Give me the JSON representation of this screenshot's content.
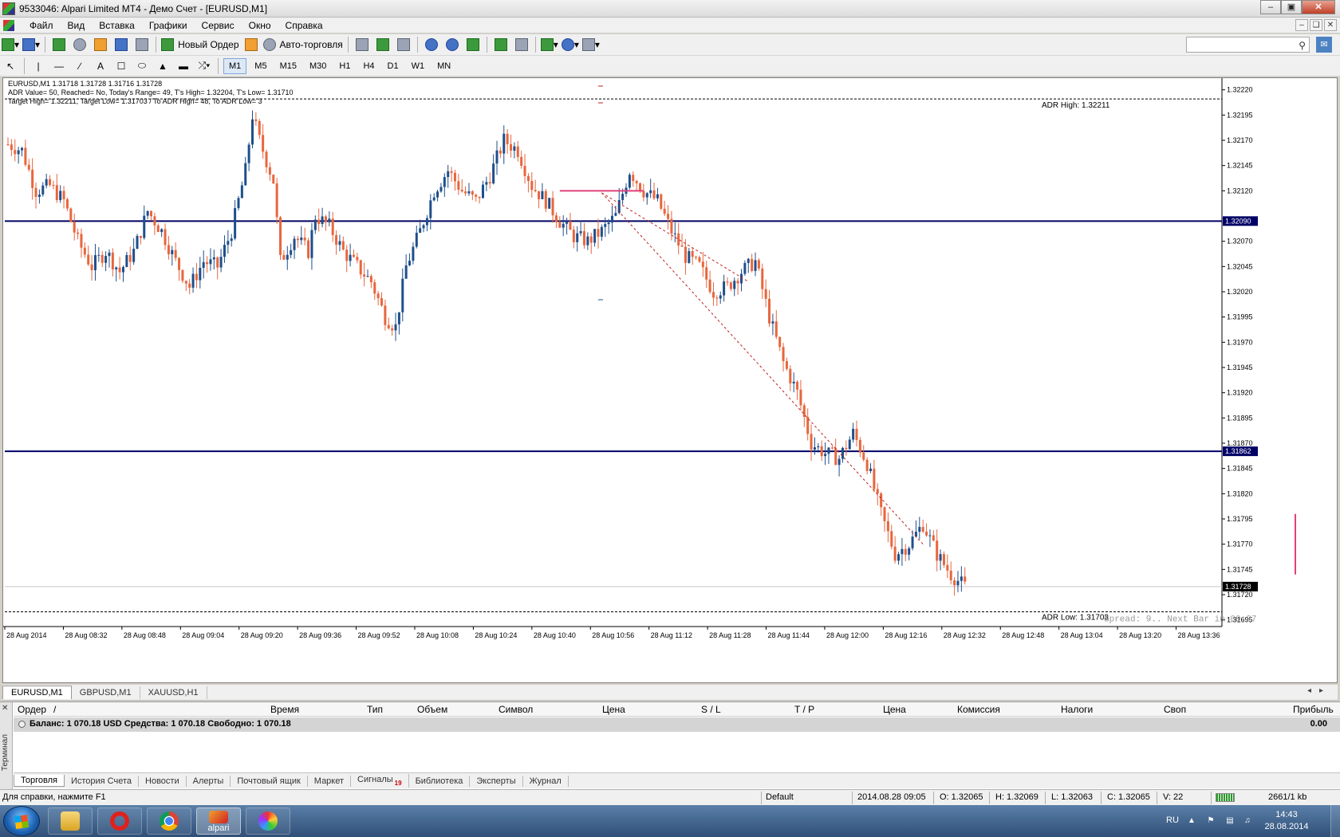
{
  "window": {
    "title": "9533046: Alpari Limited MT4 - Демо Счет - [EURUSD,M1]"
  },
  "menu": [
    "Файл",
    "Вид",
    "Вставка",
    "Графики",
    "Сервис",
    "Окно",
    "Справка"
  ],
  "toolbar": {
    "new_order_label": "Новый Ордер",
    "auto_trading_label": "Авто-торговля"
  },
  "timeframes": [
    "M1",
    "M5",
    "M15",
    "M30",
    "H1",
    "H4",
    "D1",
    "W1",
    "MN"
  ],
  "active_timeframe": "M1",
  "chart": {
    "info_line1": "EURUSD,M1  1.31718 1.31728 1.31716 1.31728",
    "info_line2": "ADR Value= 50, Reached= No, Today's Range= 49, T's High= 1.32204, T's Low= 1.31710",
    "info_line3": "Target High= 1.32211, Target Low= 1.31703 / To ADR High= 48, To ADR Low= 3",
    "adr_high_label": "ADR High: 1.32211",
    "adr_low_label": "ADR Low: 1.31703",
    "spread_label": "Spread: 9.. Next Bar in 00:27",
    "colors": {
      "bull": "#1e4f8c",
      "bear": "#e8663d",
      "hline": "#000066",
      "trend": "#c02020",
      "marker": "#e0407a"
    }
  },
  "chart_data": {
    "type": "candlestick",
    "symbol": "EURUSD",
    "timeframe": "M1",
    "ylim": [
      1.3169,
      1.3223
    ],
    "y_ticks": [
      1.3222,
      1.32195,
      1.3217,
      1.32145,
      1.3212,
      1.3207,
      1.32045,
      1.3202,
      1.31995,
      1.3197,
      1.31945,
      1.3192,
      1.31895,
      1.3187,
      1.31845,
      1.3182,
      1.31795,
      1.3177,
      1.31745,
      1.3172,
      1.31695
    ],
    "y_tick_labels": [
      "1.32220",
      "1.32195",
      "1.32170",
      "1.32145",
      "1.32120",
      "1.32070",
      "1.32045",
      "1.32020",
      "1.31995",
      "1.31970",
      "1.31945",
      "1.31920",
      "1.31895",
      "1.31870",
      "1.31845",
      "1.31820",
      "1.31795",
      "1.31770",
      "1.31745",
      "1.31720",
      "1.31695"
    ],
    "x_labels": [
      "28 Aug 2014",
      "28 Aug 08:32",
      "28 Aug 08:48",
      "28 Aug 09:04",
      "28 Aug 09:20",
      "28 Aug 09:36",
      "28 Aug 09:52",
      "28 Aug 10:08",
      "28 Aug 10:24",
      "28 Aug 10:40",
      "28 Aug 10:56",
      "28 Aug 11:12",
      "28 Aug 11:28",
      "28 Aug 11:44",
      "28 Aug 12:00",
      "28 Aug 12:16",
      "28 Aug 12:32",
      "28 Aug 12:48",
      "28 Aug 13:04",
      "28 Aug 13:20",
      "28 Aug 13:36"
    ],
    "horizontal_lines": [
      {
        "price": 1.3209,
        "label": "1.32090"
      },
      {
        "price": 1.31862,
        "label": "1.31862"
      }
    ],
    "current_price": {
      "price": 1.31728,
      "label": "1.31728"
    },
    "adr_high": 1.32211,
    "adr_low": 1.31703,
    "path_points": [
      [
        0,
        1.32166
      ],
      [
        4,
        1.3216
      ],
      [
        8,
        1.3212
      ],
      [
        12,
        1.32125
      ],
      [
        16,
        1.3211
      ],
      [
        20,
        1.3207
      ],
      [
        24,
        1.32045
      ],
      [
        28,
        1.3206
      ],
      [
        32,
        1.3204
      ],
      [
        36,
        1.3206
      ],
      [
        40,
        1.321
      ],
      [
        44,
        1.3208
      ],
      [
        48,
        1.3205
      ],
      [
        52,
        1.32025
      ],
      [
        56,
        1.3205
      ],
      [
        60,
        1.32045
      ],
      [
        64,
        1.3208
      ],
      [
        68,
        1.3214
      ],
      [
        70,
        1.32195
      ],
      [
        72,
        1.3217
      ],
      [
        76,
        1.3213
      ],
      [
        78,
        1.3205
      ],
      [
        82,
        1.32075
      ],
      [
        86,
        1.3206
      ],
      [
        88,
        1.32095
      ],
      [
        92,
        1.32085
      ],
      [
        96,
        1.3206
      ],
      [
        100,
        1.32045
      ],
      [
        104,
        1.3203
      ],
      [
        108,
        1.31995
      ],
      [
        111,
        1.31985
      ],
      [
        114,
        1.32045
      ],
      [
        118,
        1.3208
      ],
      [
        122,
        1.3212
      ],
      [
        126,
        1.3214
      ],
      [
        130,
        1.3212
      ],
      [
        134,
        1.3211
      ],
      [
        138,
        1.32135
      ],
      [
        142,
        1.3217
      ],
      [
        146,
        1.3216
      ],
      [
        150,
        1.32125
      ],
      [
        154,
        1.3211
      ],
      [
        158,
        1.3209
      ],
      [
        162,
        1.32075
      ],
      [
        166,
        1.3207
      ],
      [
        170,
        1.3208
      ],
      [
        174,
        1.32095
      ],
      [
        178,
        1.3214
      ],
      [
        182,
        1.3212
      ],
      [
        186,
        1.3211
      ],
      [
        190,
        1.3208
      ],
      [
        194,
        1.32055
      ],
      [
        198,
        1.32045
      ],
      [
        202,
        1.3202
      ],
      [
        206,
        1.32025
      ],
      [
        210,
        1.3204
      ],
      [
        214,
        1.3205
      ],
      [
        218,
        1.31995
      ],
      [
        222,
        1.3195
      ],
      [
        226,
        1.3192
      ],
      [
        230,
        1.3187
      ],
      [
        234,
        1.3186
      ],
      [
        238,
        1.31855
      ],
      [
        242,
        1.3188
      ],
      [
        246,
        1.3185
      ],
      [
        250,
        1.318
      ],
      [
        254,
        1.3176
      ],
      [
        258,
        1.3177
      ],
      [
        262,
        1.3179
      ],
      [
        266,
        1.3176
      ],
      [
        270,
        1.3174
      ],
      [
        274,
        1.31728
      ]
    ]
  },
  "chart_tabs": [
    "EURUSD,M1",
    "GBPUSD,M1",
    "XAUUSD,H1"
  ],
  "terminal": {
    "side_label": "Терминал",
    "headers": [
      "Ордер",
      "/",
      "Время",
      "Тип",
      "Объем",
      "Символ",
      "Цена",
      "S / L",
      "T / P",
      "Цена",
      "Комиссия",
      "Налоги",
      "Своп",
      "Прибыль"
    ],
    "balance_text": "Баланс: 1 070.18 USD  Средства: 1 070.18  Свободно: 1 070.18",
    "profit_total": "0.00",
    "tabs": [
      {
        "label": "Торговля",
        "badge": ""
      },
      {
        "label": "История Счета",
        "badge": ""
      },
      {
        "label": "Новости",
        "badge": ""
      },
      {
        "label": "Алерты",
        "badge": ""
      },
      {
        "label": "Почтовый ящик",
        "badge": ""
      },
      {
        "label": "Маркет",
        "badge": ""
      },
      {
        "label": "Сигналы",
        "badge": "19"
      },
      {
        "label": "Библиотека",
        "badge": ""
      },
      {
        "label": "Эксперты",
        "badge": ""
      },
      {
        "label": "Журнал",
        "badge": ""
      }
    ]
  },
  "statusbar": {
    "help": "Для справки, нажмите F1",
    "profile": "Default",
    "datetime": "2014.08.28 09:05",
    "open": "O: 1.32065",
    "high": "H: 1.32069",
    "low": "L: 1.32063",
    "close": "C: 1.32065",
    "volume": "V: 22",
    "traffic": "2661/1 kb"
  },
  "taskbar": {
    "apps": [
      "explorer",
      "opera",
      "chrome",
      "alpari",
      "paint"
    ],
    "alpari_label": "alpari",
    "lang": "RU",
    "time": "14:43",
    "date": "28.08.2014"
  }
}
